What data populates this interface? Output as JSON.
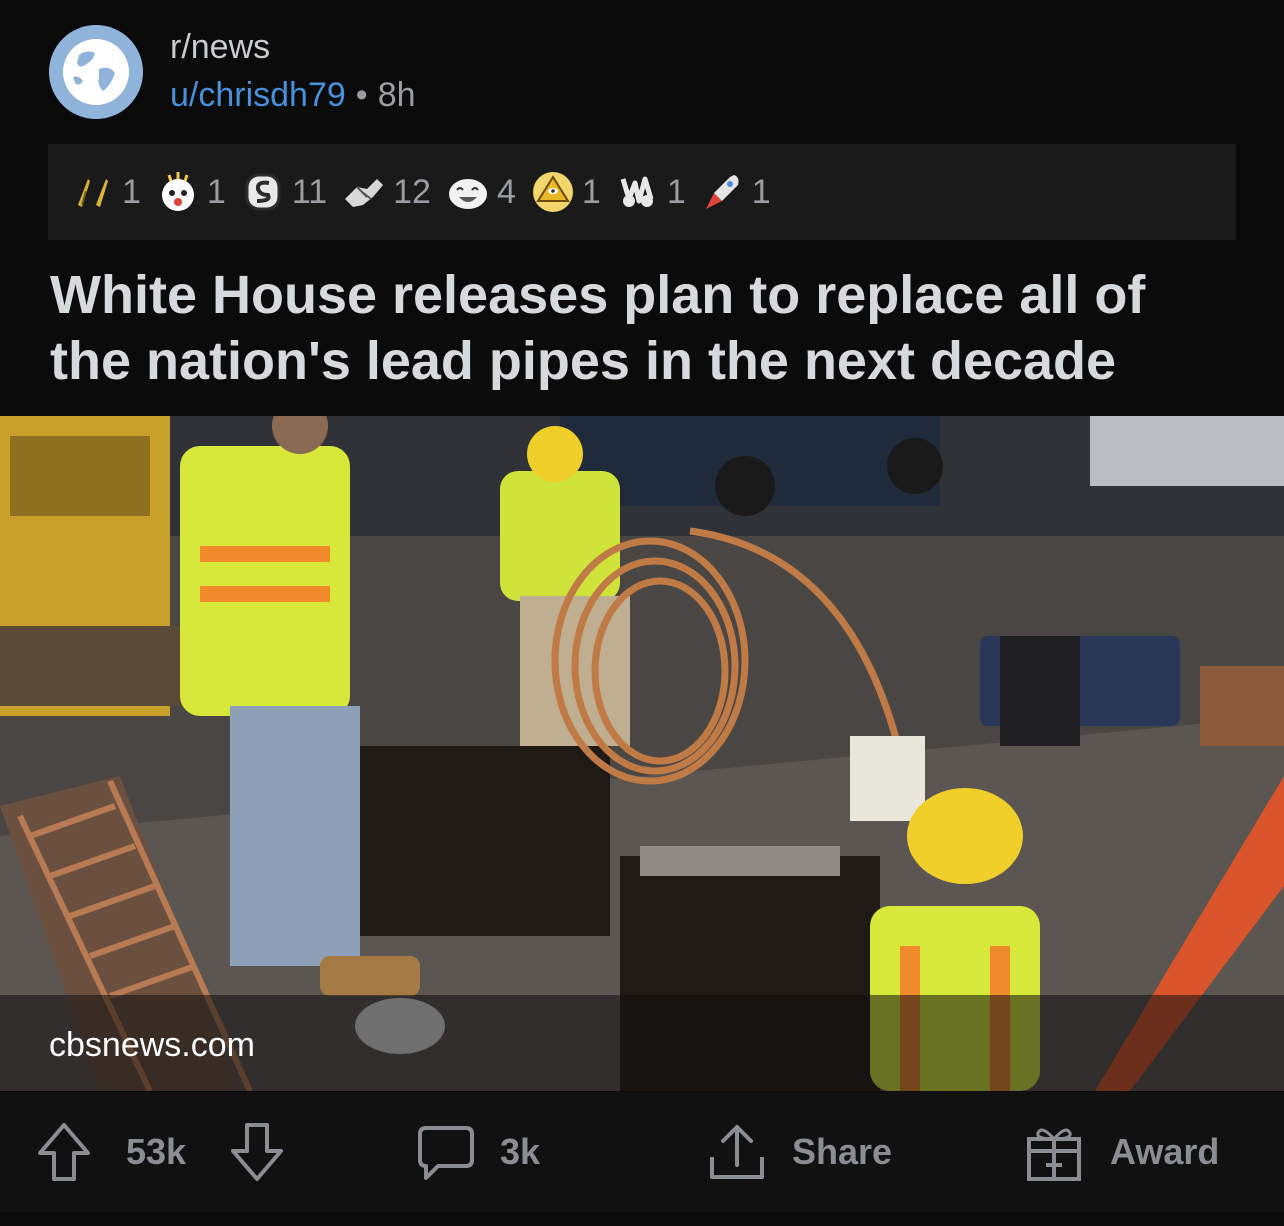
{
  "post": {
    "subreddit": "r/news",
    "author": "u/chrisdh79",
    "separator": "•",
    "age": "8h",
    "title": "White House releases plan to replace all of the nation's lead pipes in the next decade",
    "link_domain": "cbsnews.com"
  },
  "awards": [
    {
      "icon": "silver-feathers-icon",
      "count": "1"
    },
    {
      "icon": "wholesome-surprise-icon",
      "count": "1"
    },
    {
      "icon": "snek-badge-icon",
      "count": "11"
    },
    {
      "icon": "handshake-icon",
      "count": "12"
    },
    {
      "icon": "laughing-face-icon",
      "count": "4"
    },
    {
      "icon": "pyramid-eye-icon",
      "count": "1"
    },
    {
      "icon": "bunny-hands-icon",
      "count": "1"
    },
    {
      "icon": "rocket-icon",
      "count": "1"
    }
  ],
  "actions": {
    "upvotes": "53k",
    "comments": "3k",
    "share": "Share",
    "award": "Award"
  },
  "colors": {
    "background": "#0b0b0c",
    "awards_bar": "#1a1a1b",
    "username": "#4a8fd9",
    "action_gray": "#8a8d91"
  }
}
